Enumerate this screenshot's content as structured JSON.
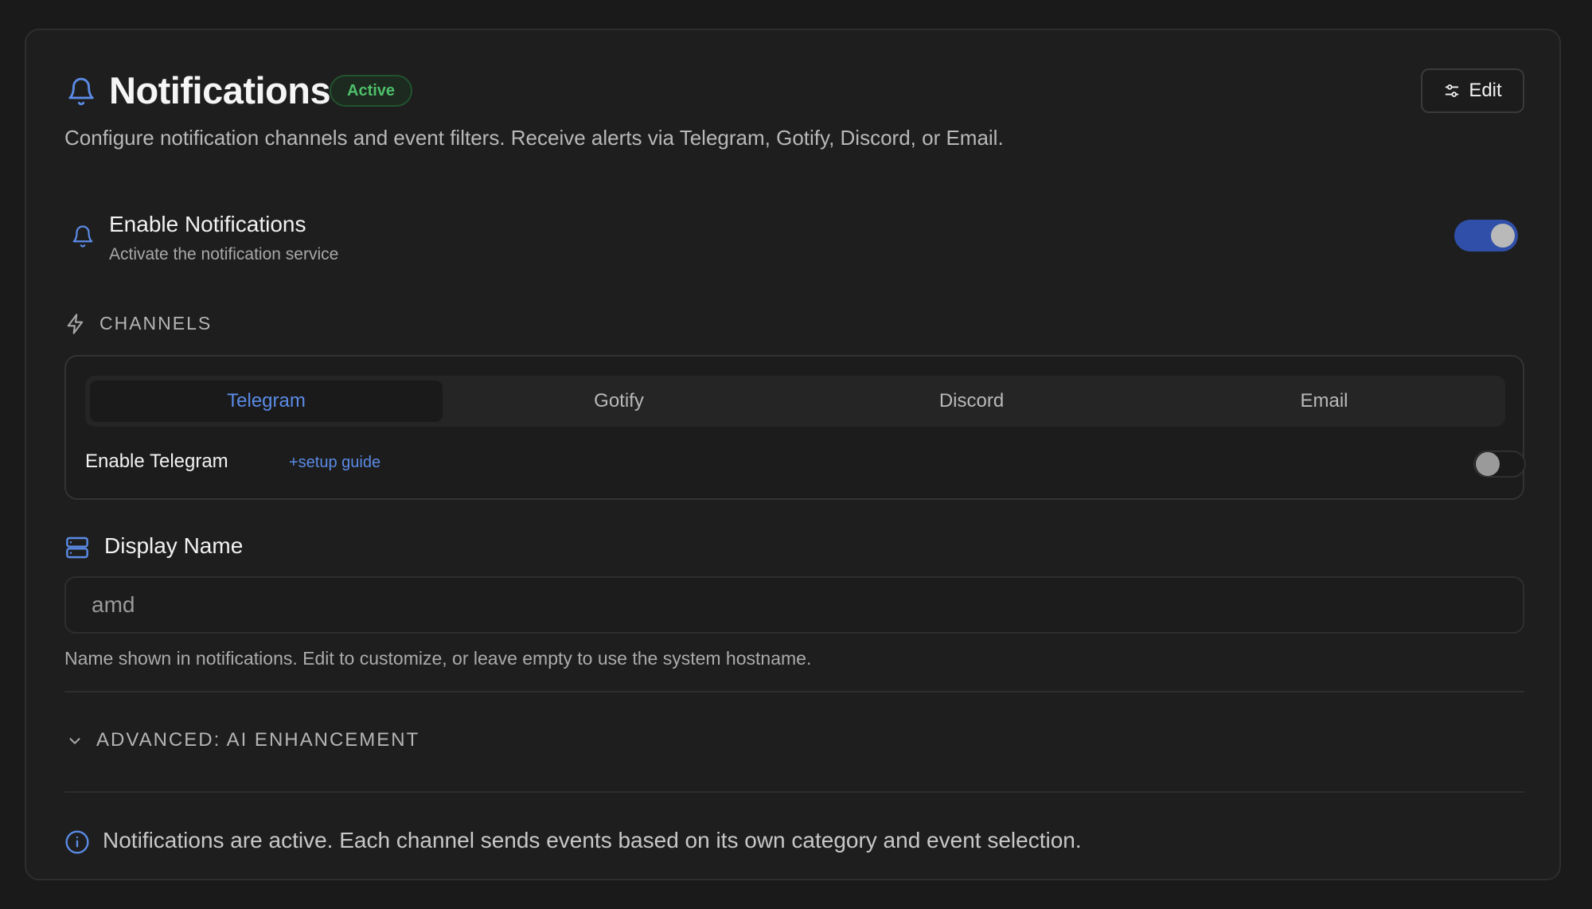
{
  "header": {
    "title": "Notifications",
    "status_badge": "Active",
    "edit_label": "Edit",
    "subtitle": "Configure notification channels and event filters. Receive alerts via Telegram, Gotify, Discord, or Email."
  },
  "enable": {
    "title": "Enable Notifications",
    "subtitle": "Activate the notification service",
    "toggle_on": true
  },
  "channels": {
    "section_label": "CHANNELS",
    "tabs": [
      {
        "label": "Telegram",
        "active": true
      },
      {
        "label": "Gotify",
        "active": false
      },
      {
        "label": "Discord",
        "active": false
      },
      {
        "label": "Email",
        "active": false
      }
    ],
    "enable_label": "Enable Telegram",
    "setup_guide": "+setup guide",
    "toggle_on": false
  },
  "display_name": {
    "label": "Display Name",
    "value": "amd",
    "help": "Name shown in notifications. Edit to customize, or leave empty to use the system hostname."
  },
  "advanced": {
    "label": "ADVANCED: AI ENHANCEMENT"
  },
  "info": {
    "text": "Notifications are active. Each channel sends events based on its own category and event selection."
  },
  "colors": {
    "accent": "#5b8be6",
    "toggle_on": "#2f4fa8",
    "success": "#4fbf6a",
    "background": "#1a1a1a"
  },
  "icons": {
    "title": "bell-icon",
    "enable": "bell-icon",
    "channels": "lightning-icon",
    "edit": "sliders-icon",
    "display_name": "server-icon",
    "advanced": "chevron-down-icon",
    "info": "info-icon"
  }
}
